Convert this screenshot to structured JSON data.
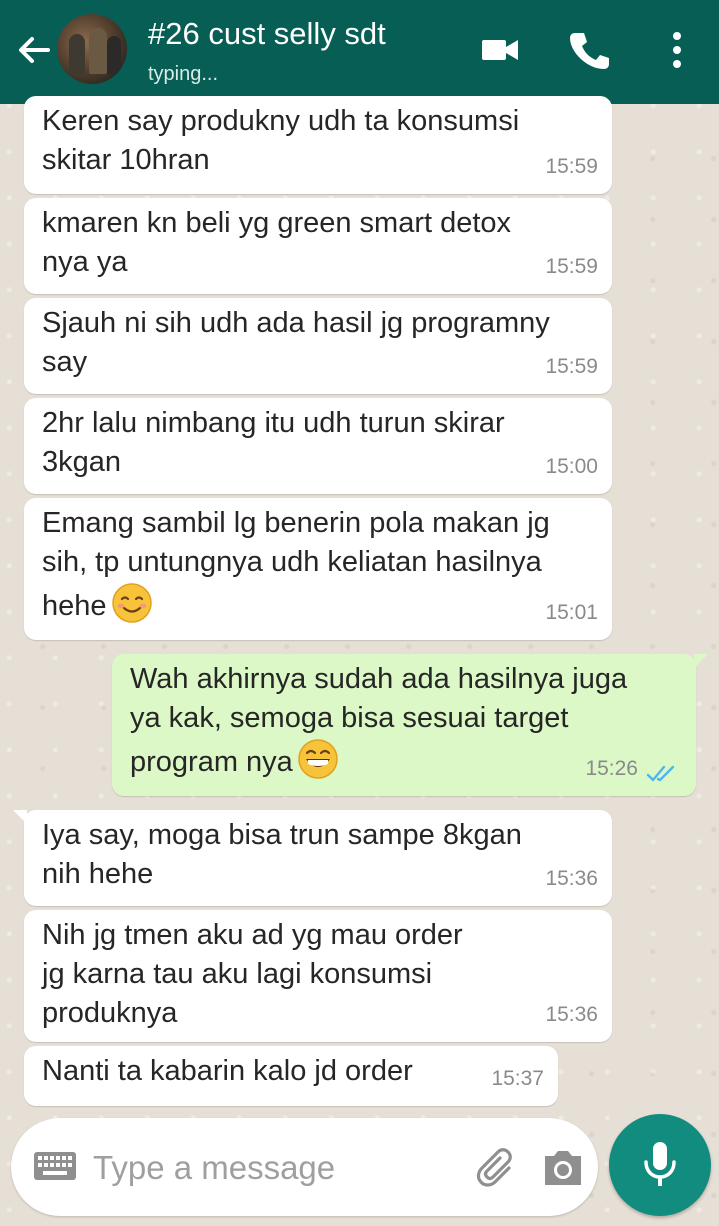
{
  "header": {
    "contact_name": "#26 cust selly sdt",
    "status": "typing...",
    "icons": [
      "back-arrow-icon",
      "avatar",
      "video-call-icon",
      "phone-call-icon",
      "more-vert-icon"
    ],
    "colors": {
      "bar": "#075e54",
      "accent": "#128c7e"
    }
  },
  "messages": [
    {
      "dir": "in",
      "text": "Keren say produkny udh ta konsumsi\nskitar 10hran",
      "time": "15:59"
    },
    {
      "dir": "in",
      "text": "kmaren kn beli yg green smart detox\nnya ya",
      "time": "15:59"
    },
    {
      "dir": "in",
      "text": "Sjauh ni sih udh ada hasil jg programny\nsay",
      "time": "15:59"
    },
    {
      "dir": "in",
      "text": "2hr lalu nimbang itu udh turun skirar\n3kgan",
      "time": "15:00"
    },
    {
      "dir": "in",
      "text": "Emang sambil lg benerin pola makan jg\nsih, tp untungnya udh keliatan hasilnya\nhehe",
      "emoji": "smiling-face-icon",
      "time": "15:01"
    },
    {
      "dir": "out",
      "text": "Wah akhirnya sudah ada hasilnya juga\nya kak, semoga bisa sesuai target\nprogram nya",
      "emoji": "grinning-face-icon",
      "time": "15:26",
      "status": "read"
    },
    {
      "dir": "in",
      "text": "Iya say, moga bisa trun sampe 8kgan\nnih hehe",
      "time": "15:36"
    },
    {
      "dir": "in",
      "text": "Nih jg tmen aku ad yg mau order\njg karna tau aku lagi konsumsi\nproduknya",
      "time": "15:36"
    },
    {
      "dir": "in",
      "text": "Nanti ta kabarin kalo jd order",
      "time": "15:37"
    }
  ],
  "composer": {
    "placeholder": "Type a message",
    "icons": [
      "keyboard-icon",
      "attach-icon",
      "camera-icon",
      "mic-icon"
    ]
  }
}
